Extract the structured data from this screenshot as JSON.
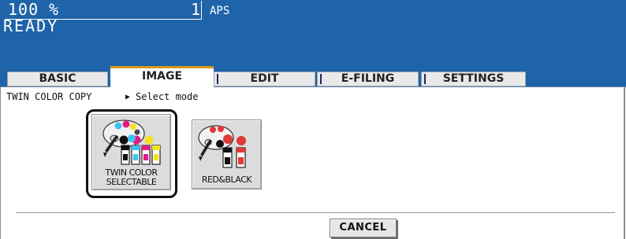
{
  "status_bar": {
    "copy_count": "100",
    "copy_count_unit": "%",
    "copy_quantity": "1",
    "paper_mode": "APS",
    "machine_status": "READY"
  },
  "tabs": [
    {
      "label": "BASIC",
      "active": false
    },
    {
      "label": "IMAGE",
      "active": true
    },
    {
      "label": "EDIT",
      "active": false
    },
    {
      "label": "E-FILING",
      "active": false
    },
    {
      "label": "SETTINGS",
      "active": false
    }
  ],
  "breadcrumb": {
    "section": "TWIN COLOR COPY",
    "arrow": "▶",
    "page": "Select mode"
  },
  "modes": [
    {
      "label_line1": "TWIN COLOR",
      "label_line2": "SELECTABLE",
      "icon": "palette-multicolor-icon",
      "selected": true
    },
    {
      "label_line1": "RED&BLACK",
      "label_line2": "",
      "icon": "palette-red-black-icon",
      "selected": false
    }
  ],
  "footer": {
    "cancel_label": "CANCEL"
  },
  "colors": {
    "header_bg": "#1f63a8",
    "active_tab_accent": "#d49a1e",
    "button_bg": "#dcdcdc"
  }
}
